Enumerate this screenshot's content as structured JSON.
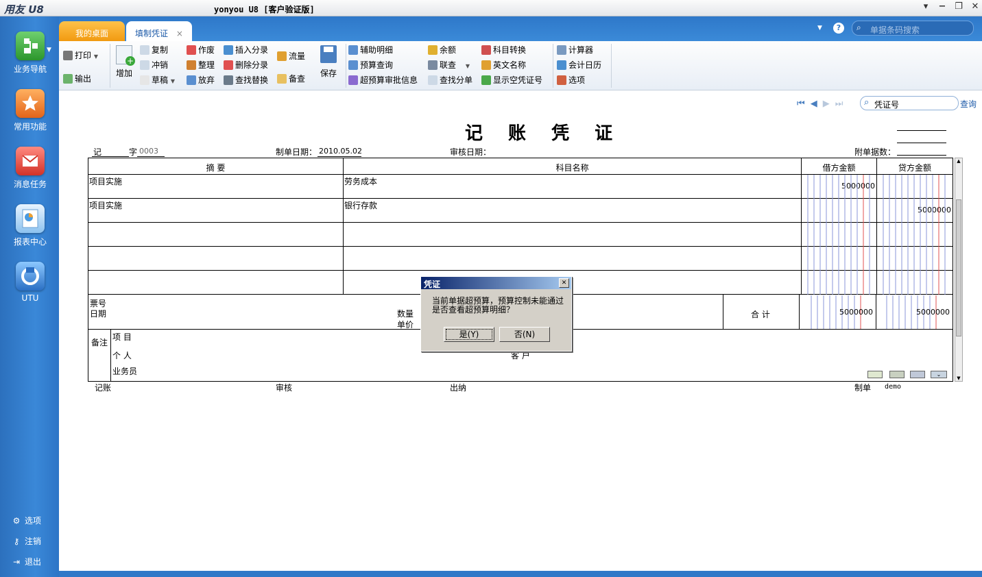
{
  "window": {
    "brand": "用友 U8",
    "title": "yonyou U8 [客户验证版]",
    "controls": [
      "▾",
      "−",
      "❐",
      "✕"
    ]
  },
  "leftnav": {
    "items": [
      {
        "label": "业务导航",
        "icon": "business-nav-icon",
        "color": "#3aa83a"
      },
      {
        "label": "常用功能",
        "icon": "favorites-star-icon",
        "color": "#f07a20"
      },
      {
        "label": "消息任务",
        "icon": "message-task-icon",
        "color": "#e0443a"
      },
      {
        "label": "报表中心",
        "icon": "report-center-icon",
        "color": "#4a9ae0"
      },
      {
        "label": "UTU",
        "icon": "utu-icon",
        "color": "#3a7fd0"
      }
    ],
    "bottom": [
      {
        "label": "选项",
        "icon": "gear-icon"
      },
      {
        "label": "注销",
        "icon": "key-icon"
      },
      {
        "label": "退出",
        "icon": "exit-icon"
      }
    ]
  },
  "tabs": {
    "desktop": "我的桌面",
    "voucher": "填制凭证",
    "close": "×",
    "search_placeholder": "单据条码搜索",
    "help": "?"
  },
  "toolbar": {
    "print": "打印",
    "export": "输出",
    "add": "增加",
    "copy": "复制",
    "reverse": "冲销",
    "draft": "草稿",
    "void": "作废",
    "arrange": "整理",
    "abandon": "放弃",
    "insert_entry": "插入分录",
    "delete_entry": "删除分录",
    "find_replace": "查找替换",
    "cashflow": "流量",
    "memo": "备查",
    "save": "保存",
    "aux_detail": "辅助明细",
    "budget_query": "预算查询",
    "over_budget_info": "超预算审批信息",
    "balance": "余额",
    "linked_query": "联查",
    "find_entry": "查找分单",
    "subject_convert": "科目转换",
    "english_name": "英文名称",
    "show_empty_no": "显示空凭证号",
    "calculator": "计算器",
    "acc_calendar": "会计日历",
    "options": "选项"
  },
  "voucher_nav": {
    "search_label": "凭证号",
    "query": "查询"
  },
  "voucher": {
    "title": "记 账 凭 证",
    "type_char": "记",
    "zi": "字",
    "number": "0003",
    "date_label": "制单日期：",
    "date": "2010.05.02",
    "audit_date_label": "审核日期：",
    "attachments_label": "附单据数：",
    "headers": {
      "summary": "摘 要",
      "subject": "科目名称",
      "debit": "借方金额",
      "credit": "贷方金额"
    },
    "rows": [
      {
        "summary": "项目实施",
        "subject": "劳务成本",
        "debit": "5000000",
        "credit": ""
      },
      {
        "summary": "项目实施",
        "subject": "银行存款",
        "debit": "",
        "credit": "5000000"
      },
      {
        "summary": "",
        "subject": "",
        "debit": "",
        "credit": ""
      },
      {
        "summary": "",
        "subject": "",
        "debit": "",
        "credit": ""
      },
      {
        "summary": "",
        "subject": "",
        "debit": "",
        "credit": ""
      }
    ],
    "footer": {
      "ticket_no": "票号",
      "date": "日期",
      "quantity": "数量",
      "unit_price": "单价",
      "total_label": "合 计",
      "total_debit": "5000000",
      "total_credit": "5000000",
      "remark": "备注",
      "project": "项 目",
      "person": "个 人",
      "customer": "客 户",
      "salesman": "业务员"
    },
    "signatures": {
      "bookkeeping": "记账",
      "audit": "审核",
      "cashier": "出纳",
      "maker_label": "制单",
      "maker": "demo"
    }
  },
  "dialog": {
    "title": "凭证",
    "message": "当前单据超预算，预算控制未能通过是否查看超预算明细？",
    "yes": "是(Y)",
    "no": "否(N)",
    "close": "✕"
  }
}
